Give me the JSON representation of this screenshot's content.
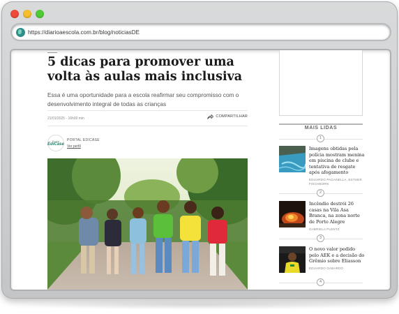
{
  "browser": {
    "url": "https://diarioaescola.com.br/blog/noticiasDE",
    "window_dots": [
      "close",
      "minimize",
      "maximize"
    ],
    "colors": {
      "close": "#ef4a3c",
      "minimize": "#f6be2c",
      "maximize": "#4fcb34"
    }
  },
  "article": {
    "headline": "5 dicas para promover uma volta às aulas mais inclusiva",
    "subtitle": "Essa é uma oportunidade para a escola reafirmar seu compromisso com o desenvolvimento integral de todas as crianças",
    "date": "21/01/2025 - 16h00 min",
    "share_label": "COMPARTILHAR",
    "author": {
      "name": "PORTAL EDICASE",
      "link_label": "Ver perfil",
      "avatar_top": "Portal",
      "avatar_main": "EdiCase"
    },
    "photo_alt_icon": "children-walking-photo"
  },
  "sidebar": {
    "section_title": "MAIS LIDAS",
    "ranks": [
      "1",
      "2",
      "3",
      "4"
    ],
    "items": [
      {
        "title": "Imagens obtidas pela polícia mostram menina em piscina de clube e tentativa de resgate após afogamento",
        "author": "EDUARDO PAGANELLA, ESTHER FISCHBORN",
        "thumb_icon": "pool-thumbnail"
      },
      {
        "title": "Incêndio destrói 26 casas na Vila Asa Branca, na zona norte de Porto Alegre",
        "author": "GABRIELA PLENTZ",
        "thumb_icon": "fire-thumbnail"
      },
      {
        "title": "O novo valor pedido pelo AEK e a decisão do Grêmio sobre Eliasson",
        "author": "EDUARDO GABARDO",
        "thumb_icon": "football-player-thumbnail"
      }
    ]
  }
}
